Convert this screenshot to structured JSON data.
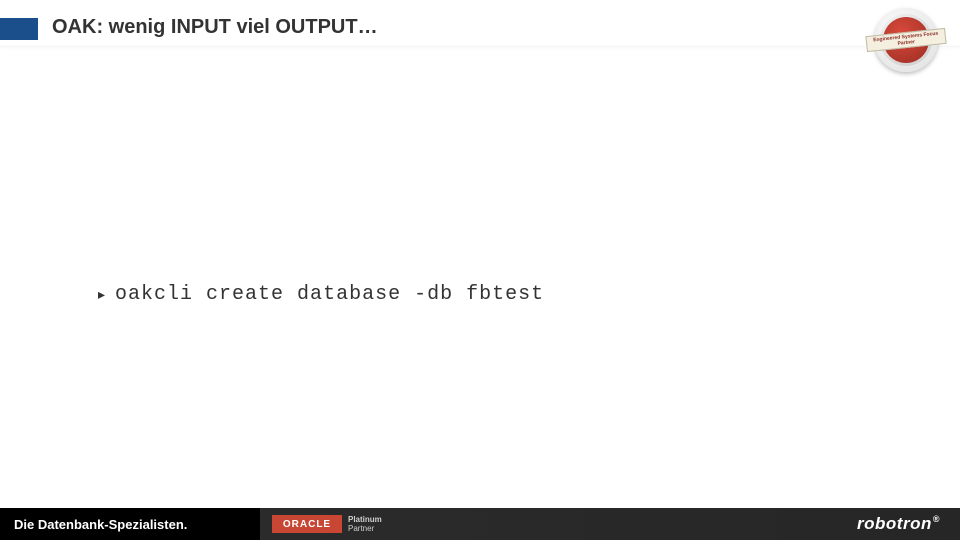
{
  "header": {
    "title": "OAK: wenig INPUT viel OUTPUT…"
  },
  "badge": {
    "label": "Engineered Systems Focus Partner"
  },
  "content": {
    "command": "oakcli create database -db fbtest"
  },
  "footer": {
    "tagline": "Die Datenbank-Spezialisten.",
    "oracle_label": "ORACLE",
    "partner_line1": "Platinum",
    "partner_line2": "Partner",
    "brand": "robotron",
    "brand_mark": "®"
  }
}
